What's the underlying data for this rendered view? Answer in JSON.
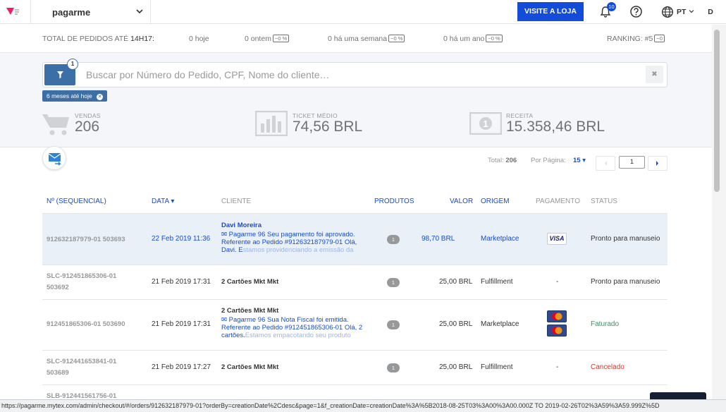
{
  "header": {
    "account_name": "pagarme",
    "visit_button": "VISITE A LOJA",
    "notifications_count": "10",
    "language": "PT",
    "avatar_initial": "D"
  },
  "summary": {
    "total_label": "TOTAL DE PEDIDOS ATÉ",
    "time": "14H17:",
    "today": "0 hoje",
    "yesterday": "0 ontem",
    "yesterday_pct": "~0 %",
    "week": "0 há uma semana",
    "week_pct": "~0 %",
    "year": "0 há um ano",
    "year_pct": "~0 %",
    "ranking": "RANKING: #5",
    "ranking_pct": "~0"
  },
  "search": {
    "placeholder": "Buscar por Número do Pedido, CPF, Nome do cliente…",
    "filter_count": "1",
    "active_tag": "6 meses até hoje"
  },
  "stats": {
    "sales_label": "VENDAS",
    "sales_value": "206",
    "ticket_label": "TICKET MÉDIO",
    "ticket_value": "74,56 BRL",
    "revenue_label": "RECEITA",
    "revenue_value": "15.358,46 BRL"
  },
  "pagination": {
    "total_label": "Total:",
    "total_value": "206",
    "per_page_label": "Por Página:",
    "per_page_value": "15",
    "page": "1"
  },
  "table": {
    "headers": {
      "order": "Nº (SEQUENCIAL)",
      "date": "DATA",
      "client": "CLIENTE",
      "products": "PRODUTOS",
      "value": "VALOR",
      "origin": "ORIGEM",
      "payment": "PAGAMENTO",
      "status": "STATUS"
    },
    "rows": [
      {
        "order": "912632187979-01 503693",
        "date": "22 Feb 2019 11:36",
        "client": "Davi Moreira",
        "message": "Pagarme 96 Seu pagamento foi aprovado. Referente ao Pedido #912632187979-01 Olá, Davi. E",
        "message_fade": "stamos providenciando a emissão da Nota Fiscal",
        "products": "1",
        "value": "98,70 BRL",
        "origin": "Marketplace",
        "payment": "VISA",
        "status": "Pronto para manuseio"
      },
      {
        "order": "SLC-912451865306-01 503692",
        "date": "21 Feb 2019 17:31",
        "client": "2 Cartões Mkt Mkt",
        "products": "1",
        "value": "25,00 BRL",
        "origin": "Fulfillment",
        "payment": "-",
        "status": "Pronto para manuseio"
      },
      {
        "order": "912451865306-01 503690",
        "date": "21 Feb 2019 17:31",
        "client": "2 Cartões Mkt Mkt",
        "message": "Pagarme 96 Sua Nota Fiscal foi emitida. Referente ao Pedido #912451865306-01 Olá, 2 cartões.",
        "message_fade": "Estamos empacotando seu produto para providen",
        "products": "1",
        "value": "25,00 BRL",
        "origin": "Marketplace",
        "payment": "mastercard",
        "status": "Faturado"
      },
      {
        "order": "SLC-912441653841-01 503689",
        "date": "21 Feb 2019 17:27",
        "client": "2 Cartões Mkt Mkt",
        "products": "1",
        "value": "25,00 BRL",
        "origin": "Fulfillment",
        "payment": "-",
        "status": "Cancelado"
      },
      {
        "order": "SLB-912441561756-01"
      }
    ]
  },
  "status_bar": {
    "url": "https://pagarme.mytex.com/admin/checkout/#/orders/912632187979-01?orderBy=creationDate%2Cdesc&page=1&f_creationDate=creationDate%3A%5B2018-08-25T03%3A00%3A00.000Z TO 2019-02-26T02%3A59%3A59.999Z%5D"
  }
}
